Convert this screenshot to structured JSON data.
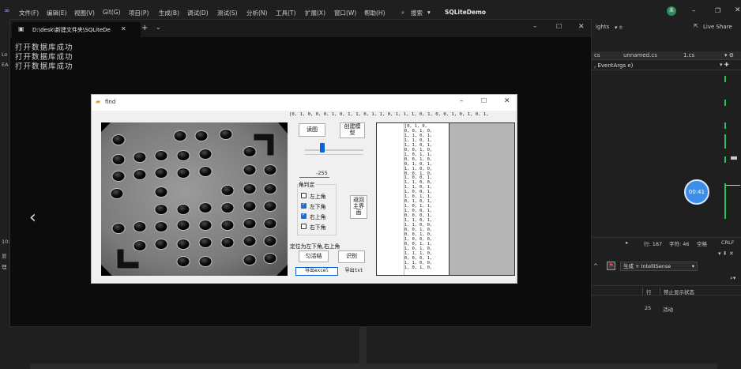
{
  "vs": {
    "menu": [
      "文件(F)",
      "编辑(E)",
      "视图(V)",
      "Git(G)",
      "项目(P)",
      "生成(B)",
      "调试(D)",
      "测试(S)",
      "分析(N)",
      "工具(T)",
      "扩展(X)",
      "窗口(W)",
      "帮助(H)"
    ],
    "search_label": "搜索",
    "app_title": "SQLiteDemo",
    "avatar_initial": "未",
    "live_share": "Live Share",
    "insights": "ights",
    "tabs": [
      "cs",
      "unnamed.cs",
      "1.cs"
    ],
    "member_dropdown": ", EventArgs e)",
    "left_edge": [
      "Lo",
      "EA",
      "10:",
      "显",
      "理"
    ],
    "timer": "00:41",
    "status": {
      "line": "行: 187",
      "char": "字符: 46",
      "space": "空格",
      "eol": "CRLF"
    },
    "error_filter": "生成 + IntelliSense",
    "error_columns": {
      "line": "行",
      "suppression": "禁止显示状态"
    },
    "error_row": {
      "line": "25",
      "state": "活动"
    }
  },
  "terminal": {
    "tab_title": "D:\\desk\\新建文件夹\\SQLiteDe",
    "lines": [
      "打开数据库成功",
      "打开数据库成功",
      "打开数据库成功"
    ]
  },
  "find": {
    "title": "find",
    "top_sequence": "[0, 1, 0, 0, 0, 1, 0, 1, 1, 0, 1, 1, 0, 1, 1, 1, 0, 1, 0, 0, 1, 0, 1, 0, 1,",
    "btn_read": "读图",
    "btn_create_template": "创建模型",
    "slider_value": 0.3,
    "threshold_value": "-255",
    "corner_group_label": "角判定",
    "checkboxes": [
      {
        "label": "左上角",
        "checked": false
      },
      {
        "label": "左下角",
        "checked": true
      },
      {
        "label": "右上角",
        "checked": true
      },
      {
        "label": "右下角",
        "checked": false
      }
    ],
    "btn_back": "返回主界面",
    "position_text": "定位为左下角,右上角",
    "btn_match": "匀活结",
    "btn_recognize": "识别",
    "btn_export_excel": "导出excel",
    "btn_export_txt": "导出txt",
    "list_rows": [
      "[0, 1, 0,",
      "0, 0, 1, 0,",
      "1, 1, 0, 1,",
      "1, 1, 0, 1,",
      "1, 1, 0, 1,",
      "0, 0, 1, 0,",
      "1, 0, 1, 1,",
      "0, 0, 1, 0,",
      "0, 1, 0, 1,",
      "1, 1, 0, 0,",
      "0, 0, 1, 0,",
      "1, 0, 0, 1,",
      "1, 1, 0, 0,",
      "1, 1, 0, 1,",
      "1, 0, 0, 1,",
      "1, 0, 1, 1,",
      "0, 1, 0, 1,",
      "1, 0, 1, 1,",
      "1, 0, 0, 1,",
      "0, 0, 0, 1,",
      "1, 1, 0, 1,",
      "1, 1, 0, 0,",
      "0, 0, 1, 0,",
      "0, 0, 1, 0,",
      "1, 0, 0, 0,",
      "0, 0, 1, 1,",
      "1, 0, 1, 0,",
      "1, 1, 1, 0,",
      "0, 0, 0, 1,",
      "1, 1, 0, 0,",
      "1, 0, 1, 0,"
    ]
  }
}
